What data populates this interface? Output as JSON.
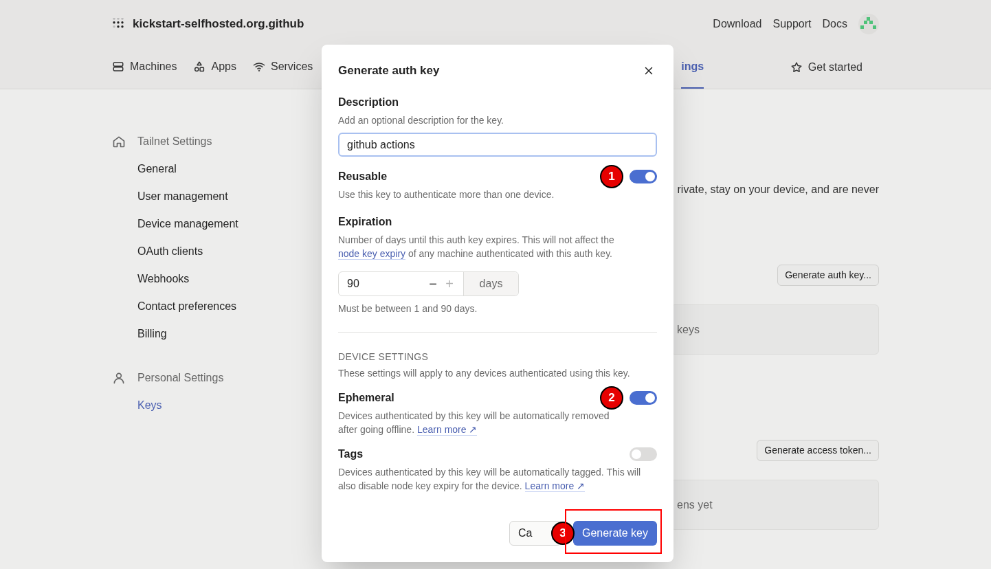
{
  "header": {
    "org_name": "kickstart-selfhosted.org.github",
    "links": [
      "Download",
      "Support",
      "Docs"
    ],
    "tabs": [
      {
        "label": "Machines",
        "kind": "server",
        "selected": false
      },
      {
        "label": "Apps",
        "kind": "shapes",
        "selected": false
      },
      {
        "label": "Services",
        "kind": "wifi",
        "selected": false
      },
      {
        "label": "ings",
        "kind": "plain",
        "selected": true
      }
    ],
    "get_started": "Get started"
  },
  "sidebar": {
    "sections": [
      {
        "title": "Tailnet Settings",
        "kind": "home",
        "items": [
          {
            "label": "General",
            "selected": false
          },
          {
            "label": "User management",
            "selected": false
          },
          {
            "label": "Device management",
            "selected": false
          },
          {
            "label": "OAuth clients",
            "selected": false
          },
          {
            "label": "Webhooks",
            "selected": false
          },
          {
            "label": "Contact preferences",
            "selected": false
          },
          {
            "label": "Billing",
            "selected": false
          }
        ]
      },
      {
        "title": "Personal Settings",
        "kind": "person",
        "items": [
          {
            "label": "Keys",
            "selected": true
          }
        ]
      }
    ]
  },
  "content": {
    "intro_fragment": "rivate, stay on your device, and are never",
    "sections": [
      {
        "button": "Generate auth key...",
        "empty_text": "keys"
      },
      {
        "button": "Generate access token...",
        "empty_text": "ens yet"
      }
    ]
  },
  "modal": {
    "title": "Generate auth key",
    "description": {
      "label": "Description",
      "hint": "Add an optional description for the key.",
      "value": "github actions"
    },
    "reusable": {
      "label": "Reusable",
      "hint": "Use this key to authenticate more than one device.",
      "on": true,
      "marker": "1"
    },
    "expiration": {
      "label": "Expiration",
      "hint_before": "Number of days until this auth key expires. This will not affect the",
      "hint_link": "node key expiry",
      "hint_after": "of any machine authenticated with this auth key.",
      "value": "90",
      "minus": "−",
      "plus": "+",
      "unit": "days",
      "note": "Must be between 1 and 90 days."
    },
    "device_settings": {
      "heading": "DEVICE SETTINGS",
      "hint": "These settings will apply to any devices authenticated using this key.",
      "toggles": [
        {
          "label": "Ephemeral",
          "hint": "Devices authenticated by this key will be automatically removed after going offline.",
          "link": "Learn more ↗",
          "on": true,
          "marker": "2"
        },
        {
          "label": "Tags",
          "hint": "Devices authenticated by this key will be automatically tagged. This will also disable node key expiry for the device.",
          "link": "Learn more ↗",
          "on": false
        }
      ]
    },
    "cancel": "Ca",
    "submit": "Generate key",
    "submit_marker": "3"
  }
}
